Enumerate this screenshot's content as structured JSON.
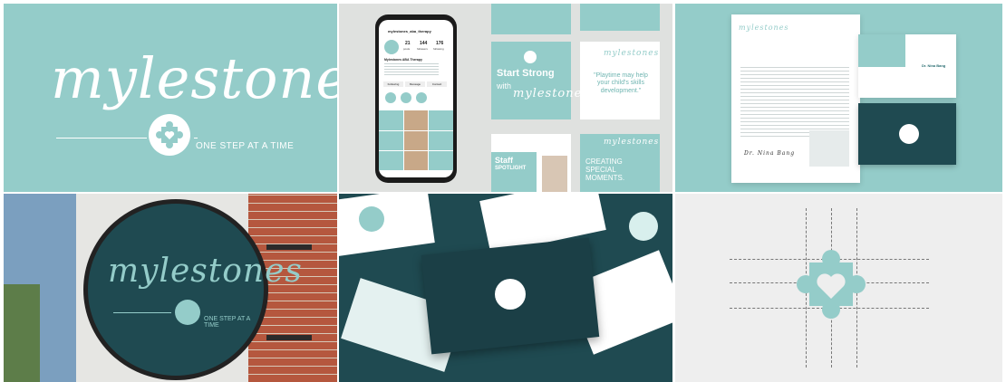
{
  "brand": {
    "wordmark": "mylestones",
    "tagline": "ONE STEP AT A TIME"
  },
  "instagram": {
    "handle": "mylestones_aba_therapy",
    "posts": "21",
    "posts_label": "posts",
    "followers": "144",
    "followers_label": "followers",
    "following": "176",
    "following_label": "following",
    "display_name": "Mylestones ABA Therapy",
    "follow_button": "Following",
    "message_button": "Message",
    "contact_button": "Contact"
  },
  "social_posts": {
    "start_strong": "Start Strong",
    "with": "with",
    "playtime_quote": "\"Playtime may help your child's skills development.\"",
    "staff": "Staff",
    "spotlight": "SPOTLIGHT",
    "creating": "CREATING",
    "special": "SPECIAL",
    "moments": "MOMENTS."
  },
  "stationery": {
    "doctor_name": "Dr. Nina Bang",
    "signature": "Dr. Nina Bang"
  },
  "colors": {
    "teal": "#94ccc9",
    "dark_teal": "#1f4a51",
    "white": "#ffffff"
  }
}
